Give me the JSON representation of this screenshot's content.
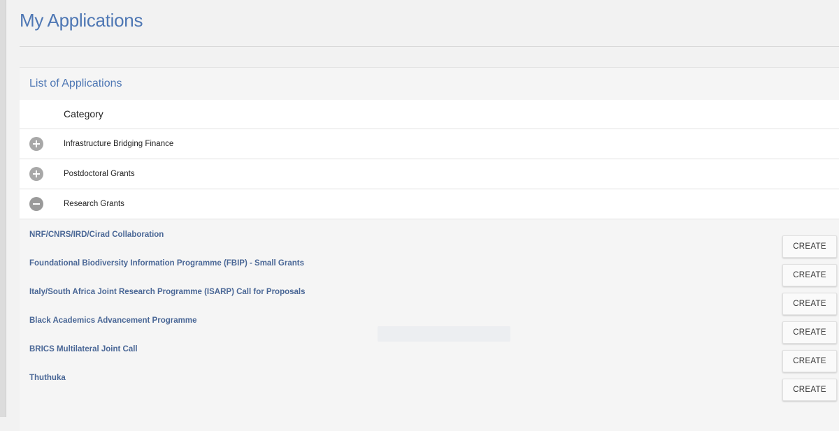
{
  "page": {
    "title": "My Applications"
  },
  "panel": {
    "title": "List of Applications",
    "column_header": "Category"
  },
  "categories": [
    {
      "label": "Infrastructure Bridging Finance",
      "state": "collapsed",
      "icon": "plus-circle-icon"
    },
    {
      "label": "Postdoctoral Grants",
      "state": "collapsed",
      "icon": "plus-circle-icon"
    },
    {
      "label": "Research Grants",
      "state": "expanded",
      "icon": "minus-circle-icon"
    }
  ],
  "grants": [
    {
      "name": "NRF/CNRS/IRD/Cirad Collaboration",
      "action": "CREATE"
    },
    {
      "name": "Foundational Biodiversity Information Programme (FBIP) - Small Grants",
      "action": "CREATE"
    },
    {
      "name": "Italy/South Africa Joint Research Programme (ISARP) Call for Proposals",
      "action": "CREATE"
    },
    {
      "name": "Black Academics Advancement Programme",
      "action": "CREATE"
    },
    {
      "name": "BRICS Multilateral Joint Call",
      "action": "CREATE"
    },
    {
      "name": "Thuthuka",
      "action": "CREATE"
    }
  ],
  "colors": {
    "accent": "#4e77b4",
    "grant_link": "#4a6796",
    "toggle": "#a8a8a8"
  }
}
